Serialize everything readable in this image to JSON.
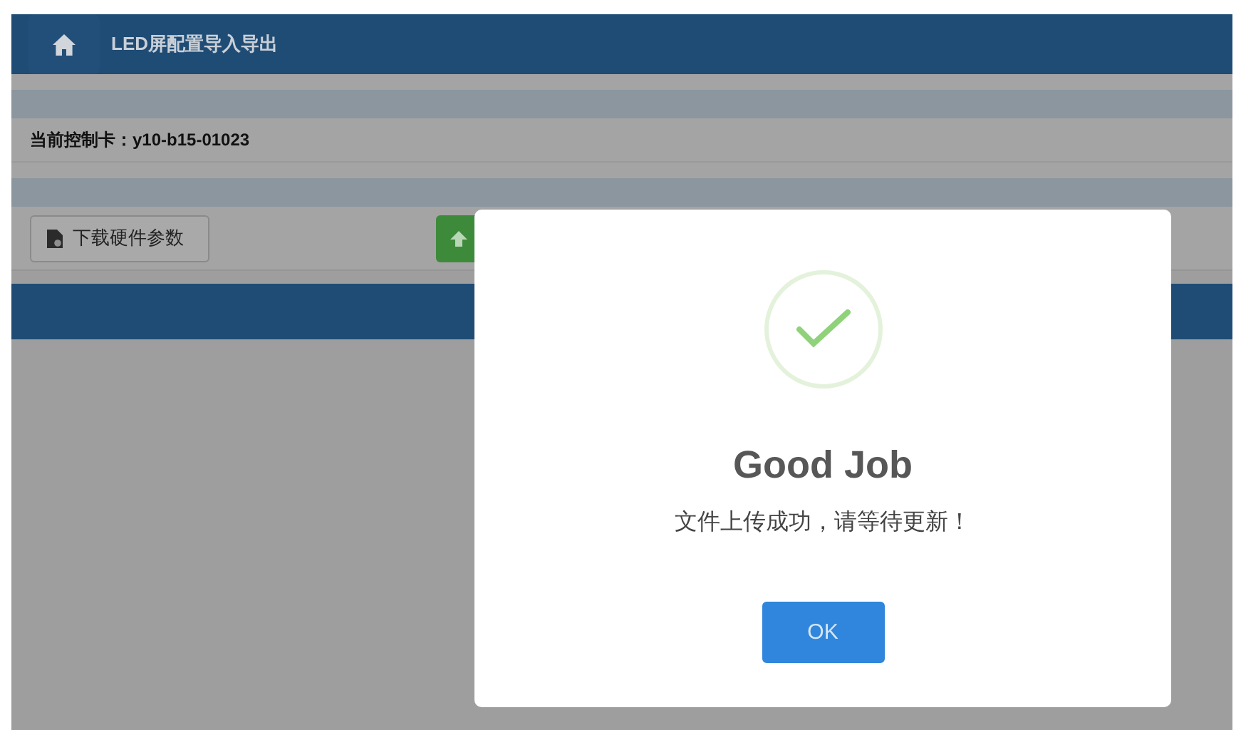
{
  "header": {
    "title": "LED屏配置导入导出"
  },
  "control_card": {
    "text": "当前控制卡：y10-b15-01023"
  },
  "toolbar": [
    {
      "kind": "download",
      "label": "下载硬件参数"
    },
    {
      "kind": "upload"
    }
  ],
  "dialog": {
    "kind": "success",
    "title": "Good Job",
    "message": "文件上传成功，请等待更新！",
    "button": "OK"
  }
}
